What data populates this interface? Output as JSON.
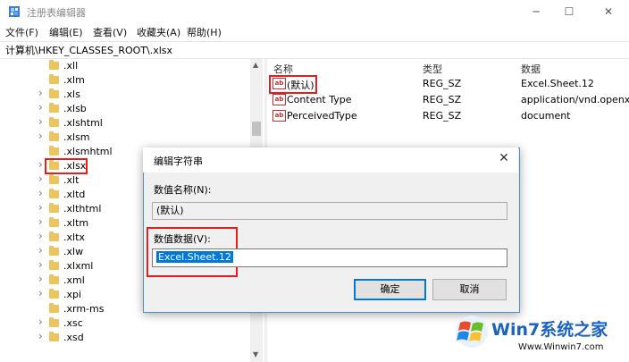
{
  "window": {
    "title": "注册表编辑器",
    "minimize": "─",
    "maximize": "☐",
    "close": "✕"
  },
  "menu": [
    "文件(F)",
    "编辑(E)",
    "查看(V)",
    "收藏夹(A)",
    "帮助(H)"
  ],
  "address": "计算机\\HKEY_CLASSES_ROOT\\.xlsx",
  "tree": [
    {
      "label": ".xll",
      "expandable": false
    },
    {
      "label": ".xlm",
      "expandable": false
    },
    {
      "label": ".xls",
      "expandable": true
    },
    {
      "label": ".xlsb",
      "expandable": true
    },
    {
      "label": ".xlshtml",
      "expandable": true
    },
    {
      "label": ".xlsm",
      "expandable": true
    },
    {
      "label": ".xlsmhtml",
      "expandable": false
    },
    {
      "label": ".xlsx",
      "expandable": true,
      "highlighted": true
    },
    {
      "label": ".xlt",
      "expandable": true
    },
    {
      "label": ".xltd",
      "expandable": true
    },
    {
      "label": ".xlthtml",
      "expandable": true
    },
    {
      "label": ".xltm",
      "expandable": true
    },
    {
      "label": ".xltx",
      "expandable": true
    },
    {
      "label": ".xlw",
      "expandable": true
    },
    {
      "label": ".xlxml",
      "expandable": true
    },
    {
      "label": ".xml",
      "expandable": true
    },
    {
      "label": ".xpi",
      "expandable": true
    },
    {
      "label": ".xrm-ms",
      "expandable": false
    },
    {
      "label": ".xsc",
      "expandable": true
    },
    {
      "label": ".xsd",
      "expandable": true
    }
  ],
  "list": {
    "columns": [
      "名称",
      "类型",
      "数据"
    ],
    "rows": [
      {
        "name": "(默认)",
        "type": "REG_SZ",
        "data": "Excel.Sheet.12"
      },
      {
        "name": "Content Type",
        "type": "REG_SZ",
        "data": "application/vnd.openx"
      },
      {
        "name": "PerceivedType",
        "type": "REG_SZ",
        "data": "document"
      }
    ]
  },
  "dialog": {
    "title": "编辑字符串",
    "value_name_label": "数值名称(N):",
    "value_name": "(默认)",
    "value_data_label": "数值数据(V):",
    "value_data": "Excel.Sheet.12",
    "ok": "确定",
    "cancel": "取消",
    "close": "✕"
  },
  "icons": {
    "value": "ab-icon",
    "folder": "folder-icon",
    "expand": "chevron-right-icon"
  },
  "colors": {
    "highlight": "#e02020",
    "selection": "#0078d7",
    "folder": "#e9c45f"
  },
  "watermark": {
    "title": "Win7系统之家",
    "url": "Www.Winwin7.com"
  }
}
